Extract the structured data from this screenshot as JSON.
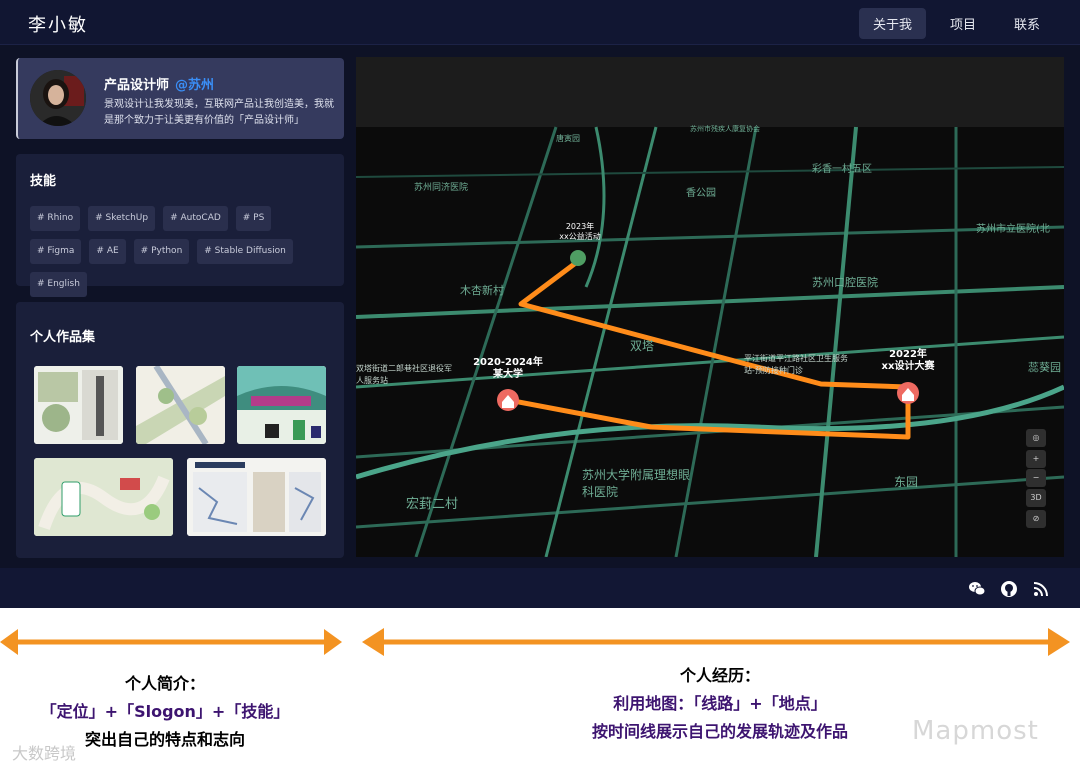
{
  "app": {
    "logo": "李小敏",
    "nav": [
      {
        "label": "关于我",
        "active": true
      },
      {
        "label": "项目",
        "active": false
      },
      {
        "label": "联系",
        "active": false
      }
    ]
  },
  "profile": {
    "title": "产品设计师",
    "location": "@苏州",
    "description": "景观设计让我发现美，互联网产品让我创造美，我就是那个致力于让美更有价值的「产品设计师」"
  },
  "skills": {
    "title": "技能",
    "tags": [
      "# Rhino",
      "# SketchUp",
      "# AutoCAD",
      "# PS",
      "# Figma",
      "# AE",
      "# Python",
      "# Stable Diffusion",
      "# English"
    ]
  },
  "portfolio": {
    "title": "个人作品集"
  },
  "map": {
    "places": {
      "p1": "苏州市残疾人康复协会",
      "p2": "苏州同济医院",
      "p3": "彩香一村五区",
      "p4": "香公园",
      "p5": "苏州市立医院(北",
      "p6": "木杏新村",
      "p7": "苏州口腔医院",
      "p8": "双塔",
      "p9": "平江街道平江路社区卫生服务站-预防接种门诊",
      "p10": "双塔街道二郎巷社区退役军人服务站",
      "p11": "苏州大学附属理想眼科医院",
      "p12": "宏葑二村",
      "p13": "东园",
      "p14": "蕊葵园",
      "p15": "唐寅园"
    },
    "markers": [
      {
        "year": "2023年",
        "label": "xx公益活动"
      },
      {
        "year": "2020-2024年",
        "label": "某大学"
      },
      {
        "year": "2022年",
        "label": "xx设计大赛"
      }
    ],
    "controls": [
      "◎",
      "+",
      "−",
      "3D",
      "⊘"
    ],
    "route_color": "#ff8c1a"
  },
  "annotations": {
    "left_title": "个人简介：",
    "left_line": "「定位」+「Slogon」+「技能」",
    "left_line2": "突出自己的特点和志向",
    "right_title": "个人经历：",
    "right_line": "利用地图：「线路」+「地点」",
    "right_line2": "按时间线展示自己的发展轨迹及作品",
    "arrow_color": "#f39322"
  },
  "watermarks": {
    "left": "大数跨境",
    "right": "Mapmost"
  }
}
